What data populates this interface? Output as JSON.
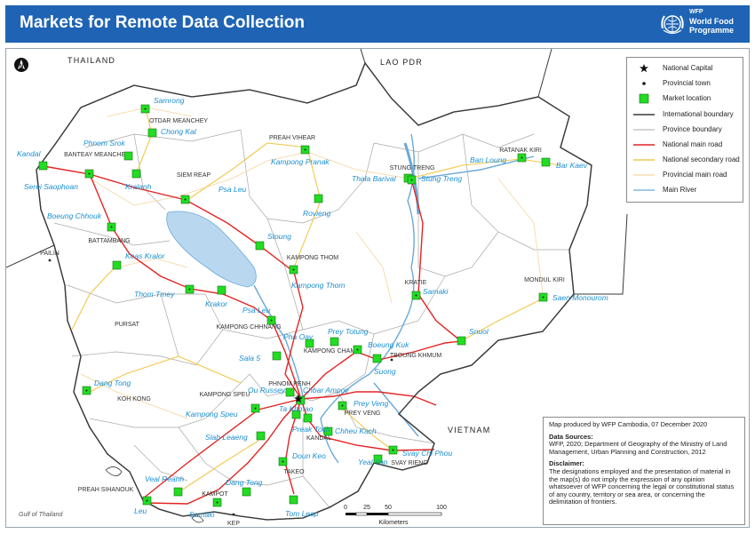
{
  "title": "Markets for Remote Data Collection",
  "logo": {
    "abbr": "WFP",
    "name": "World Food Programme"
  },
  "colors": {
    "title_bar": "#1f64b4",
    "market": "#22dd22",
    "national_road": "#e32424",
    "secondary_road": "#f2c84b",
    "provincial_road": "#f7ddb0",
    "river": "#6aa9d8",
    "province_boundary": "#a8a8a8",
    "international_boundary": "#3a3a3a",
    "lake": "#b9d8f0",
    "sea": "#ffffff"
  },
  "legend": {
    "items": [
      {
        "label": "National Capital",
        "symbol": "star-icon"
      },
      {
        "label": "Provincial town",
        "symbol": "dot-icon"
      },
      {
        "label": "Market location",
        "symbol": "green-square-icon"
      },
      {
        "label": "International boundary",
        "symbol": "dark-line"
      },
      {
        "label": "Province boundary",
        "symbol": "grey-line"
      },
      {
        "label": "National main road",
        "symbol": "red-line"
      },
      {
        "label": "National secondary road",
        "symbol": "yellow-line"
      },
      {
        "label": "Provincial main road",
        "symbol": "beige-line"
      },
      {
        "label": "Main River",
        "symbol": "blue-line"
      }
    ]
  },
  "countries": [
    "THAILAND",
    "LAO PDR",
    "VIETNAM",
    "Gulf of Thailand"
  ],
  "provinces": [
    "OTDAR MEANCHEY",
    "BANTEAY MEANCHEY",
    "PREAH VIHEAR",
    "STUNG TRENG",
    "RATANAK KIRI",
    "SIEM REAP",
    "BATTAMBANG",
    "PAILIN",
    "KAMPONG THOM",
    "MONDUL KIRI",
    "KRATIE",
    "PURSAT",
    "KAMPONG CHHNANG",
    "KAMPONG CHAM",
    "TBOUNG KHMUM",
    "KOH KONG",
    "KAMPONG SPEU",
    "PHNOM PENH",
    "KANDAL",
    "PREY VENG",
    "SVAY RIENG",
    "TAKEO",
    "PREAH SIHANOUK",
    "KAMPOT",
    "KEP"
  ],
  "markets": [
    "Samrong",
    "Chong Kal",
    "Phnom Srok",
    "Kandal",
    "Serei Saophoan",
    "Kralanh",
    "Psa Leu",
    "Kampong Pranak",
    "Rovieng",
    "Thala Barival",
    "Stung Treng",
    "Ban Loung",
    "Bar Kaev",
    "Boeung Chhouk",
    "Stoung",
    "Koas Kralor",
    "Kampong Thom",
    "Thom Tmey",
    "Krakor",
    "Psa Leu",
    "Samaki",
    "Saen Monourom",
    "Pha Oav",
    "Prey Totung",
    "Boeung Kuk",
    "Snuol",
    "Sala 5",
    "Suong",
    "Dang Tong",
    "Ou Russey",
    "Chbar Ampov",
    "Prey Veng",
    "Kampong Speu",
    "Ta Khmao",
    "Preak Toch",
    "Chheu Kach",
    "Slab Leaeng",
    "Doun Keo",
    "Svay Chi Phou",
    "Yeal Yon",
    "Veal Reanh",
    "Dang Tong",
    "Leu",
    "Samaki",
    "Tom Leap"
  ],
  "scale": {
    "ticks": [
      "0",
      "25",
      "50",
      "100"
    ],
    "unit": "Kilometers"
  },
  "north": "N",
  "info": {
    "produced": "Map produced by WFP Cambodia, 07 December 2020",
    "sources_title": "Data Sources:",
    "sources": "WFP, 2020; Department of Geography of the Ministry of Land Management, Urban Planning and Construction, 2012",
    "disclaimer_title": "Disclaimer:",
    "disclaimer": "The designations employed and the presentation of material in the map(s) do not imply the expression of any opinion whatsoever of WFP concerning the legal or constitutional status of any country, territory or sea area, or concerning the delimitation of frontiers."
  }
}
